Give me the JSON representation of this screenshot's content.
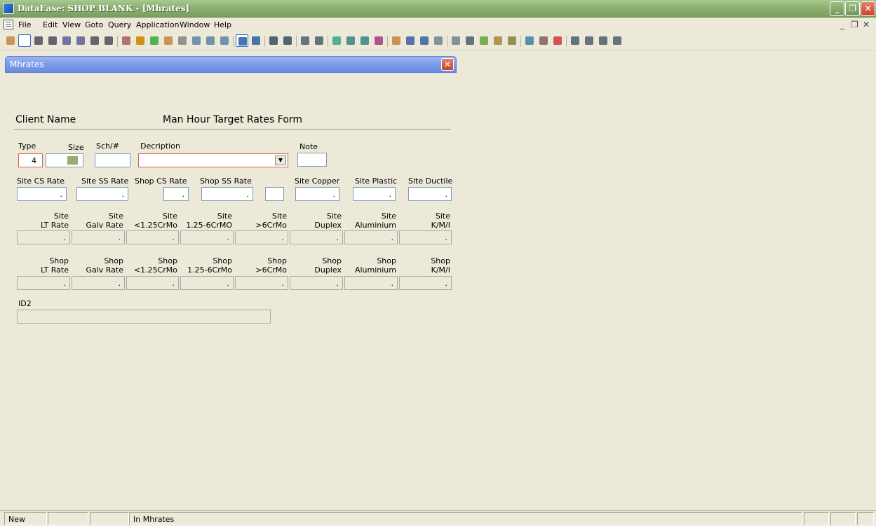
{
  "window": {
    "title": "DataEase: SHOP BLANK - [Mhrates]",
    "minimize": "_",
    "restore": "❐",
    "close": "✕"
  },
  "menu": {
    "items": [
      "File",
      "Edit",
      "View",
      "Goto",
      "Query",
      "Application",
      "Window",
      "Help"
    ],
    "mdi_minimize": "_",
    "mdi_restore": "❐",
    "mdi_close": "✕"
  },
  "toolbar": {
    "icons": [
      "tool-icon",
      "new-record-icon",
      "first-record-icon",
      "prev-page-icon",
      "prev-record-icon",
      "next-record-icon",
      "next-page-icon",
      "last-record-icon",
      "save-record-icon",
      "modify-icon",
      "query-icon",
      "sort-icon",
      "clear-icon",
      "cut-icon",
      "copy-icon",
      "paste-icon",
      "form-view-icon",
      "table-view-icon",
      "print-icon",
      "report-icon",
      "zoom-out-icon",
      "zoom-in-icon",
      "edit-icon",
      "record-icon",
      "find-icon",
      "tag-icon",
      "pencil-icon",
      "user-icon",
      "help-icon",
      "copy-doc-icon",
      "paste-doc-icon",
      "scissors-icon",
      "graph-icon",
      "clipboard-icon",
      "settings-icon",
      "wizard-icon",
      "db-icon",
      "link-icon",
      "filter-icon",
      "filter-apply-icon",
      "properties-icon",
      "layout-icon"
    ]
  },
  "form": {
    "window_title": "Mhrates",
    "close": "✕",
    "client_name_label": "Client Name",
    "form_title": "Man Hour Target Rates Form",
    "type_label": "Type",
    "type_value": "4",
    "size_label": "Size",
    "sch_label": "Sch/#",
    "description_label": "Decription",
    "note_label": "Note",
    "site_cs_label": "Site CS Rate",
    "site_ss_label": "Site SS Rate",
    "shop_cs_label": "Shop CS Rate",
    "shop_ss_label": "Shop SS Rate",
    "site_copper_label": "Site Copper",
    "site_plastic_label": "Site Plastic",
    "site_ductile_label": "Site Ductile",
    "decimal_placeholder": ".",
    "site_rates": [
      {
        "line1": "Site",
        "line2": "LT Rate"
      },
      {
        "line1": "Site",
        "line2": "Galv Rate"
      },
      {
        "line1": "Site",
        "line2": "<1.25CrMo"
      },
      {
        "line1": "Site",
        "line2": "1.25-6CrMO"
      },
      {
        "line1": "Site",
        "line2": ">6CrMo"
      },
      {
        "line1": "Site",
        "line2": "Duplex"
      },
      {
        "line1": "Site",
        "line2": "Aluminium"
      },
      {
        "line1": "Site",
        "line2": "K/M/I"
      }
    ],
    "shop_rates": [
      {
        "line1": "Shop",
        "line2": "LT Rate"
      },
      {
        "line1": "Shop",
        "line2": "Galv Rate"
      },
      {
        "line1": "Shop",
        "line2": "<1.25CrMo"
      },
      {
        "line1": "Shop",
        "line2": "1.25-6CrMo"
      },
      {
        "line1": "Shop",
        "line2": ">6CrMo"
      },
      {
        "line1": "Shop",
        "line2": "Duplex"
      },
      {
        "line1": "Shop",
        "line2": "Aluminium"
      },
      {
        "line1": "Shop",
        "line2": "K/M/I"
      }
    ],
    "id2_label": "ID2"
  },
  "status": {
    "mode": "New",
    "message": "In Mhrates"
  }
}
